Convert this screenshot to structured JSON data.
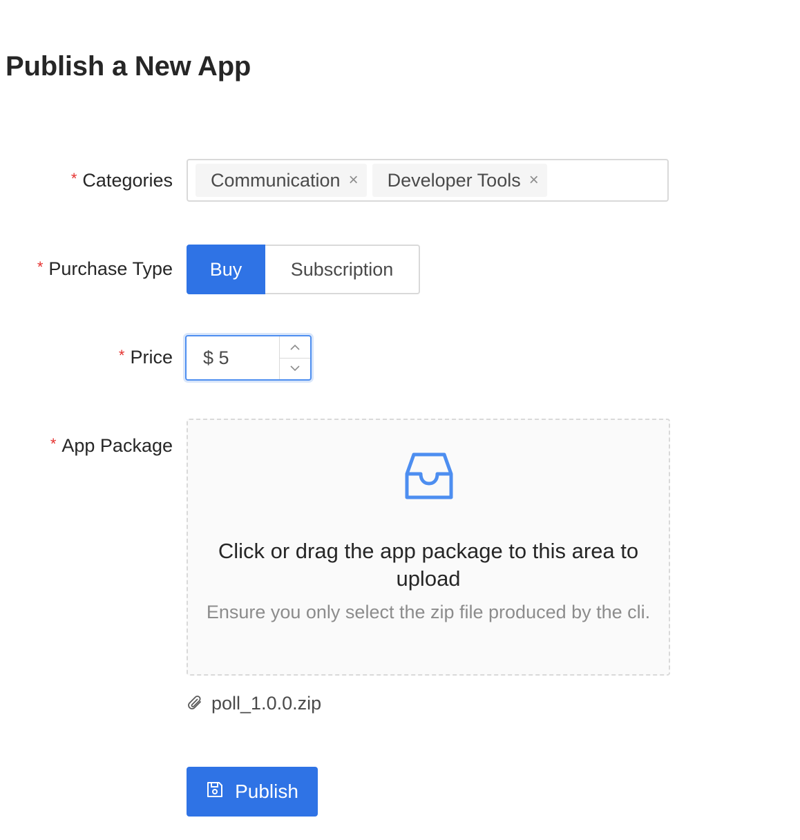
{
  "page": {
    "title": "Publish a New App"
  },
  "form": {
    "categories": {
      "label": "Categories",
      "tags": [
        "Communication",
        "Developer Tools"
      ],
      "remove_glyph": "×"
    },
    "purchase_type": {
      "label": "Purchase Type",
      "options": [
        "Buy",
        "Subscription"
      ],
      "selected": "Buy"
    },
    "price": {
      "label": "Price",
      "value": "$ 5"
    },
    "app_package": {
      "label": "App Package",
      "upload_text": "Click or drag the app package to this area to upload",
      "upload_hint": "Ensure you only select the zip file produced by the cli.",
      "file_name": "poll_1.0.0.zip"
    },
    "required_marker": "*",
    "submit_label": "Publish"
  },
  "colors": {
    "primary": "#2f73e5",
    "required": "#e5312f",
    "border": "#d9d9d9",
    "hint_text": "#8c8c8c"
  },
  "icons": {
    "upload_zone": "inbox-icon",
    "file": "paperclip-icon",
    "publish": "save-icon",
    "stepper_up": "chevron-up-icon",
    "stepper_down": "chevron-down-icon",
    "tag_remove": "close-icon"
  }
}
